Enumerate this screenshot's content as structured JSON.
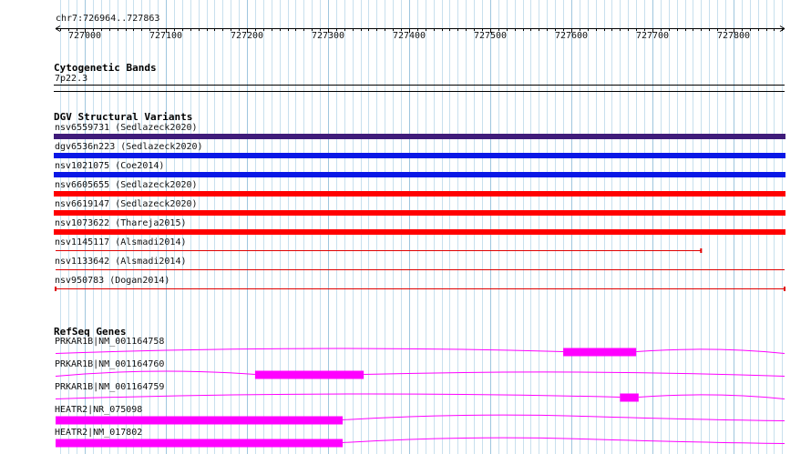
{
  "locus": "chr7:726964..727863",
  "ruler": {
    "start": 726964,
    "end": 727863,
    "labels": [
      "727000",
      "727100",
      "727200",
      "727300",
      "727400",
      "727500",
      "727600",
      "727700",
      "727800"
    ],
    "positions": [
      727000,
      727100,
      727200,
      727300,
      727400,
      727500,
      727600,
      727700,
      727800
    ]
  },
  "tracks": {
    "cytoband": {
      "title": "Cytogenetic Bands",
      "band": "7p22.3"
    },
    "dgv": {
      "title": "DGV Structural Variants",
      "features": [
        {
          "label": "nsv6559731 (Sedlazeck2020)",
          "color": "#3f1c7a",
          "style": "thick",
          "start": 726964,
          "end": 727863
        },
        {
          "label": "dgv6536n223 (Sedlazeck2020)",
          "color": "#0a18e6",
          "style": "thick",
          "start": 726964,
          "end": 727863
        },
        {
          "label": "nsv1021075 (Coe2014)",
          "color": "#0a18e6",
          "style": "thick",
          "start": 726964,
          "end": 727863
        },
        {
          "label": "nsv6605655 (Sedlazeck2020)",
          "color": "#ff0000",
          "style": "thick",
          "start": 726964,
          "end": 727863
        },
        {
          "label": "nsv6619147 (Sedlazeck2020)",
          "color": "#ff0000",
          "style": "thick",
          "start": 726964,
          "end": 727863
        },
        {
          "label": "nsv1073622 (Thareja2015)",
          "color": "#ff0000",
          "style": "thick",
          "start": 726964,
          "end": 727863
        },
        {
          "label": "nsv1145117 (Alsmadi2014)",
          "color": "#e00000",
          "style": "thin",
          "start": 726964,
          "end": 727760,
          "endTick": true
        },
        {
          "label": "nsv1133642 (Alsmadi2014)",
          "color": "#e00000",
          "style": "thin",
          "start": 726964,
          "end": 727863
        },
        {
          "label": "nsv950783 (Dogan2014)",
          "color": "#e00000",
          "style": "thin",
          "start": 726964,
          "end": 727863,
          "startTick": true,
          "endTick": true
        }
      ]
    },
    "refseq": {
      "title": "RefSeq Genes",
      "color": "#ff00ff",
      "genes": [
        {
          "label": "PRKAR1B|NM_001164758",
          "intron": [
            [
              726964,
              726964
            ],
            [
              727365,
              727608
            ],
            [
              727685,
              727863
            ]
          ],
          "exons": [
            [
              727590,
              727680
            ]
          ]
        },
        {
          "label": "PRKAR1B|NM_001164760",
          "intron": [
            [
              726964,
              727200
            ],
            [
              727340,
              727863
            ]
          ],
          "exons": [
            [
              727210,
              727344
            ]
          ]
        },
        {
          "label": "PRKAR1B|NM_001164759",
          "intron": [
            [
              726964,
              727350
            ],
            [
              727470,
              727650
            ],
            [
              727863,
              727863
            ]
          ],
          "exons": [
            [
              727660,
              727683
            ]
          ]
        },
        {
          "label": "HEATR2|NR_075098",
          "intron": [
            [
              727317,
              727450
            ],
            [
              727560,
              727738
            ],
            [
              727863,
              727863
            ]
          ],
          "exons": [
            [
              726964,
              727318
            ]
          ]
        },
        {
          "label": "HEATR2|NM_017802",
          "intron": [
            [
              727317,
              727455
            ],
            [
              727560,
              727740
            ],
            [
              727863,
              727863
            ]
          ],
          "exons": [
            [
              726964,
              727318
            ]
          ]
        }
      ]
    }
  }
}
